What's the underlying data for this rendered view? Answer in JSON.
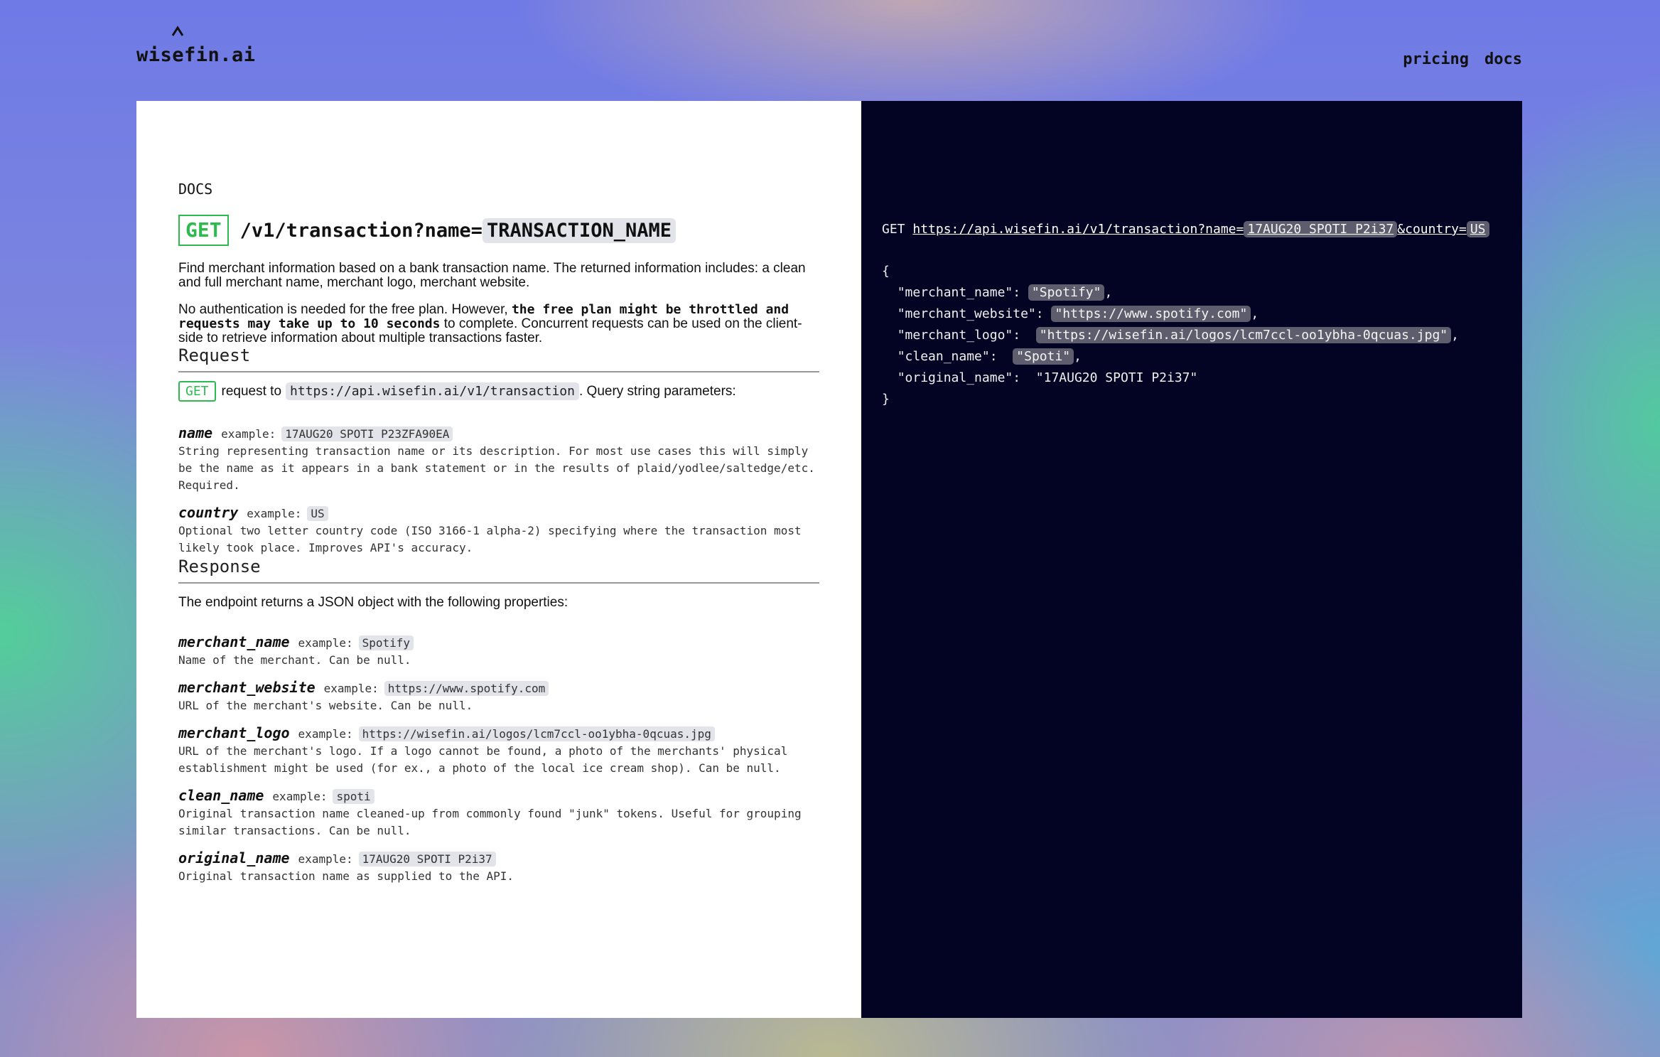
{
  "header": {
    "logo": "wisefin.ai",
    "nav": [
      {
        "label": "pricing"
      },
      {
        "label": "docs"
      }
    ]
  },
  "doc": {
    "section_label": "DOCS",
    "method": "GET",
    "path": "/v1/transaction?name=",
    "path_param": "TRANSACTION_NAME",
    "desc1": "Find merchant information based on a bank transaction name. The returned information includes: a clean and full merchant name, merchant logo, merchant website.",
    "desc2_before": "No authentication is needed for the free plan. However, ",
    "desc2_bold": "the free plan might be throttled and requests may take up to 10 seconds",
    "desc2_after": " to complete. Concurrent requests can be used on the client-side to retrieve information about multiple transactions faster.",
    "request": {
      "title": "Request",
      "method": "GET",
      "text_before": "request to",
      "url": "https://api.wisefin.ai/v1/transaction",
      "text_after": ". Query string parameters:",
      "params": [
        {
          "name": "name",
          "example_label": "example:",
          "example": "17AUG20 SPOTI P23ZFA90EA",
          "desc": "String representing transaction name or its description. For most use cases this will simply be the name as it appears in a bank statement or in the results of plaid/yodlee/saltedge/etc. Required."
        },
        {
          "name": "country",
          "example_label": "example:",
          "example": "US",
          "desc": "Optional two letter country code (ISO 3166-1 alpha-2) specifying where the transaction most likely took place. Improves API's accuracy."
        }
      ]
    },
    "response": {
      "title": "Response",
      "intro": "The endpoint returns a JSON object with the following properties:",
      "props": [
        {
          "name": "merchant_name",
          "example_label": "example:",
          "example": "Spotify",
          "desc": "Name of the merchant. Can be null."
        },
        {
          "name": "merchant_website",
          "example_label": "example:",
          "example": "https://www.spotify.com",
          "desc": "URL of the merchant's website. Can be null."
        },
        {
          "name": "merchant_logo",
          "example_label": "example:",
          "example": "https://wisefin.ai/logos/lcm7ccl-oo1ybha-0qcuas.jpg",
          "desc": "URL of the merchant's logo. If a logo cannot be found, a photo of the merchants' physical establishment might be used (for ex., a photo of the local ice cream shop). Can be null."
        },
        {
          "name": "clean_name",
          "example_label": "example:",
          "example": "spoti",
          "desc": "Original transaction name cleaned-up from commonly found \"junk\" tokens. Useful for grouping similar transactions. Can be null."
        },
        {
          "name": "original_name",
          "example_label": "example:",
          "example": "17AUG20 SPOTI P2i37",
          "desc": "Original transaction name as supplied to the API."
        }
      ]
    }
  },
  "example": {
    "method": "GET",
    "url_base": "https://api.wisefin.ai/v1/transaction?name=",
    "url_name": "17AUG20 SPOTI P2i37",
    "url_country_key": "&country=",
    "url_country": "US",
    "open_brace": "{",
    "close_brace": "}",
    "fields": [
      {
        "key": "\"merchant_name\":",
        "value": "\"Spotify\"",
        "highlight": true,
        "comma": ","
      },
      {
        "key": "\"merchant_website\":",
        "value": "\"https://www.spotify.com\"",
        "highlight": true,
        "comma": ","
      },
      {
        "key": "\"merchant_logo\":",
        "value": "\"https://wisefin.ai/logos/lcm7ccl-oo1ybha-0qcuas.jpg\"",
        "highlight": true,
        "comma": ","
      },
      {
        "key": "\"clean_name\":",
        "value": "\"Spoti\"",
        "highlight": true,
        "comma": ","
      },
      {
        "key": "\"original_name\":",
        "value": "\"17AUG20 SPOTI P2i37\"",
        "highlight": false,
        "comma": ""
      }
    ]
  },
  "colors": {
    "accent_green": "#2dbb4f",
    "code_panel_bg": "#030324",
    "chip_bg": "#e3e3ea"
  }
}
